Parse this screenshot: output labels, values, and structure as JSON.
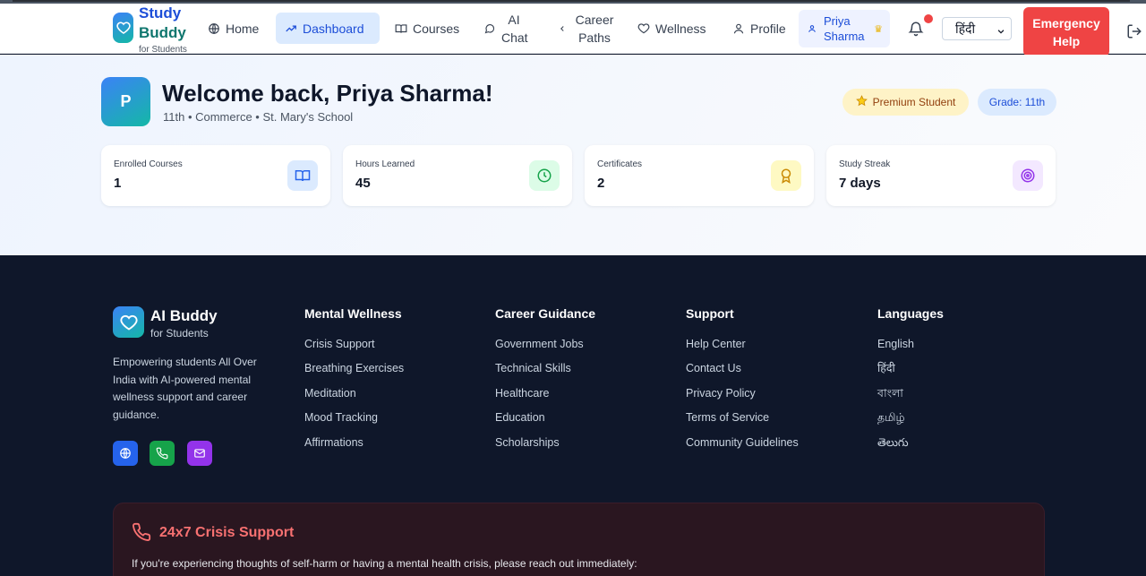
{
  "brand": {
    "name_line1": "Study",
    "name_line2": "Buddy",
    "subtitle": "for Students"
  },
  "nav": {
    "home": "Home",
    "dashboard": "Dashboard",
    "courses": "Courses",
    "ai_chat": "AI Chat",
    "career_paths": "Career Paths",
    "wellness": "Wellness",
    "profile": "Profile"
  },
  "user": {
    "name": "Priya Sharma"
  },
  "language_select": {
    "selected": "हिंदी"
  },
  "emergency": {
    "label": "Emergency Help"
  },
  "dashboard": {
    "avatar_initial": "P",
    "welcome": "Welcome back, Priya Sharma!",
    "subline": "11th • Commerce • St. Mary's School",
    "premium_badge": "Premium Student",
    "grade_badge": "Grade: 11th",
    "stats": [
      {
        "label": "Enrolled Courses",
        "value": "1",
        "icon": "book-icon",
        "color": "#dbeafe"
      },
      {
        "label": "Hours Learned",
        "value": "45",
        "icon": "clock-icon",
        "color": "#dcfce7"
      },
      {
        "label": "Certificates",
        "value": "2",
        "icon": "award-icon",
        "color": "#fef9c3"
      },
      {
        "label": "Study Streak",
        "value": "7 days",
        "icon": "target-icon",
        "color": "#f3e8ff"
      }
    ]
  },
  "footer": {
    "brand": "AI Buddy",
    "brand_sub": "for Students",
    "description": "Empowering students All Over India with AI-powered mental wellness support and career guidance.",
    "columns": [
      {
        "title": "Mental Wellness",
        "links": [
          "Crisis Support",
          "Breathing Exercises",
          "Meditation",
          "Mood Tracking",
          "Affirmations"
        ]
      },
      {
        "title": "Career Guidance",
        "links": [
          "Government Jobs",
          "Technical Skills",
          "Healthcare",
          "Education",
          "Scholarships"
        ]
      },
      {
        "title": "Support",
        "links": [
          "Help Center",
          "Contact Us",
          "Privacy Policy",
          "Terms of Service",
          "Community Guidelines"
        ]
      },
      {
        "title": "Languages",
        "links": [
          "English",
          "हिंदी",
          "বাংলা",
          "தமிழ்",
          "తెలుగు"
        ]
      }
    ],
    "crisis": {
      "title": "24x7 Crisis Support",
      "text": "If you're experiencing thoughts of self-harm or having a mental health crisis, please reach out immediately:"
    }
  },
  "colors": {
    "primary": "#1d4ed8",
    "teal": "#14b8a6",
    "emergency": "#ef4444",
    "footer_bg": "#0f172a"
  }
}
